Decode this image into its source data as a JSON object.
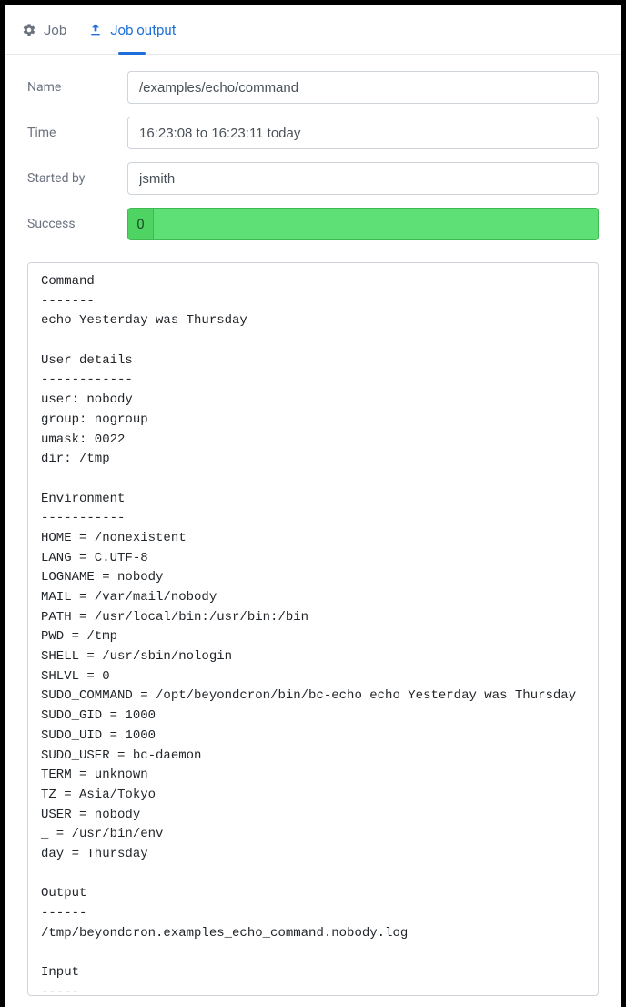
{
  "tabs": {
    "job": "Job",
    "job_output": "Job output"
  },
  "form": {
    "name_label": "Name",
    "name_value": "/examples/echo/command",
    "time_label": "Time",
    "time_value": "16:23:08 to 16:23:11 today",
    "started_by_label": "Started by",
    "started_by_value": "jsmith",
    "success_label": "Success",
    "success_code": "0"
  },
  "output_text": "Command\n-------\necho Yesterday was Thursday\n\nUser details\n------------\nuser: nobody\ngroup: nogroup\numask: 0022\ndir: /tmp\n\nEnvironment\n-----------\nHOME = /nonexistent\nLANG = C.UTF-8\nLOGNAME = nobody\nMAIL = /var/mail/nobody\nPATH = /usr/local/bin:/usr/bin:/bin\nPWD = /tmp\nSHELL = /usr/sbin/nologin\nSHLVL = 0\nSUDO_COMMAND = /opt/beyondcron/bin/bc-echo echo Yesterday was Thursday\nSUDO_GID = 1000\nSUDO_UID = 1000\nSUDO_USER = bc-daemon\nTERM = unknown\nTZ = Asia/Tokyo\nUSER = nobody\n_ = /usr/bin/env\nday = Thursday\n\nOutput\n------\n/tmp/beyondcron.examples_echo_command.nobody.log\n\nInput\n-----"
}
